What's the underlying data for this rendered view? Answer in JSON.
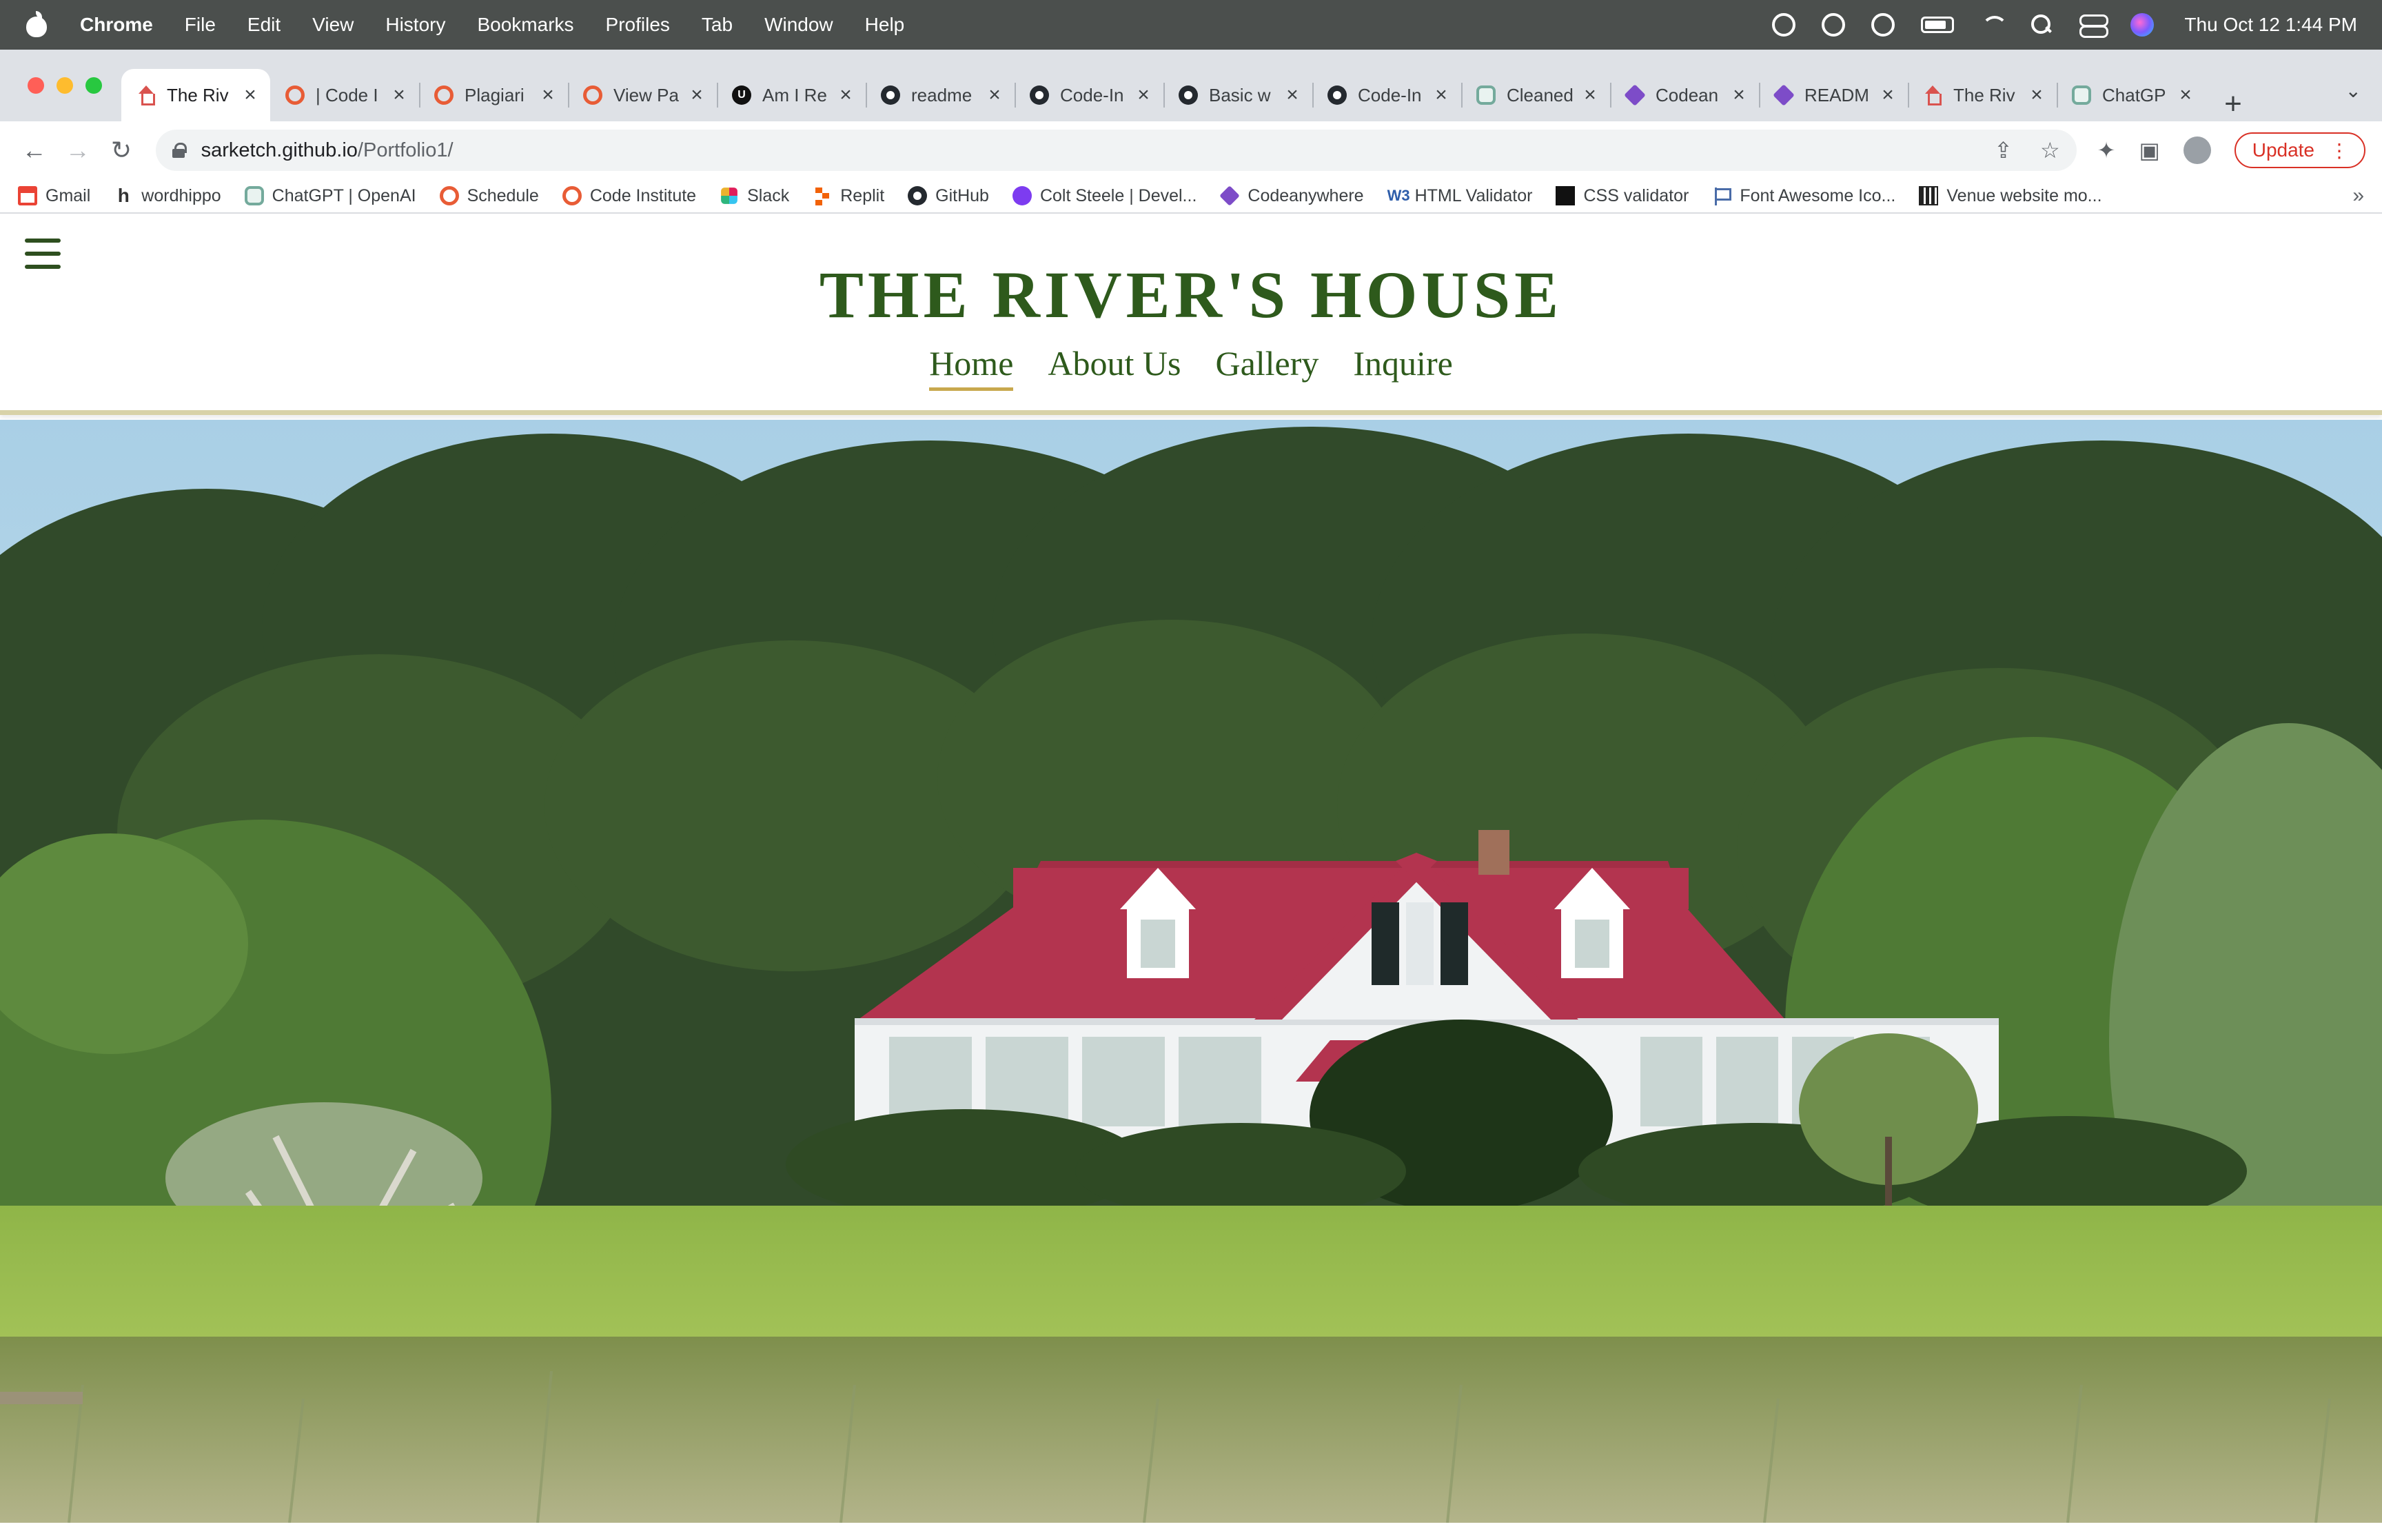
{
  "menubar": {
    "app_name": "Chrome",
    "menus": [
      "File",
      "Edit",
      "View",
      "History",
      "Bookmarks",
      "Profiles",
      "Tab",
      "Window",
      "Help"
    ],
    "clock": "Thu Oct 12  1:44 PM"
  },
  "tabs": [
    {
      "title": "The Riv",
      "icon": "house-icon",
      "active": true
    },
    {
      "title": "| Code I",
      "icon": "code-institute-icon"
    },
    {
      "title": "Plagiari",
      "icon": "code-institute-icon"
    },
    {
      "title": "View Pa",
      "icon": "code-institute-icon"
    },
    {
      "title": "Am I Re",
      "icon": "am-i-responsive-icon"
    },
    {
      "title": "readme",
      "icon": "github-icon"
    },
    {
      "title": "Code-In",
      "icon": "github-icon"
    },
    {
      "title": "Basic w",
      "icon": "github-icon"
    },
    {
      "title": "Code-In",
      "icon": "github-icon"
    },
    {
      "title": "Cleaned",
      "icon": "chatgpt-icon"
    },
    {
      "title": "Codean",
      "icon": "codeanywhere-icon"
    },
    {
      "title": "READM",
      "icon": "codeanywhere-icon"
    },
    {
      "title": "The Riv",
      "icon": "house-icon"
    },
    {
      "title": "ChatGP",
      "icon": "chatgpt-icon"
    }
  ],
  "toolbar": {
    "url_host": "sarketch.github.io",
    "url_path": "/Portfolio1/",
    "update_label": "Update"
  },
  "bookmarks": [
    {
      "label": "Gmail",
      "icon": "gmail-icon"
    },
    {
      "label": "wordhippo",
      "icon": "wordhippo-icon"
    },
    {
      "label": "ChatGPT | OpenAI",
      "icon": "chatgpt-icon"
    },
    {
      "label": "Schedule",
      "icon": "code-institute-icon"
    },
    {
      "label": "Code Institute",
      "icon": "code-institute-icon"
    },
    {
      "label": "Slack",
      "icon": "slack-icon"
    },
    {
      "label": "Replit",
      "icon": "replit-icon"
    },
    {
      "label": "GitHub",
      "icon": "github-icon"
    },
    {
      "label": "Colt Steele | Devel...",
      "icon": "colt-steele-icon"
    },
    {
      "label": "Codeanywhere",
      "icon": "codeanywhere-icon"
    },
    {
      "label": "HTML Validator",
      "icon": "w3c-icon"
    },
    {
      "label": "CSS validator",
      "icon": "css-validator-icon"
    },
    {
      "label": "Font Awesome Ico...",
      "icon": "flag-icon"
    },
    {
      "label": "Venue website mo...",
      "icon": "venue-icon"
    }
  ],
  "site": {
    "title": "THE RIVER'S HOUSE",
    "nav": [
      {
        "label": "Home",
        "active": true
      },
      {
        "label": "About Us"
      },
      {
        "label": "Gallery"
      },
      {
        "label": "Inquire"
      }
    ],
    "colors": {
      "brand_green": "#2e5a1c",
      "nav_underline": "#c8a84d",
      "roof": "#b3344f"
    }
  }
}
